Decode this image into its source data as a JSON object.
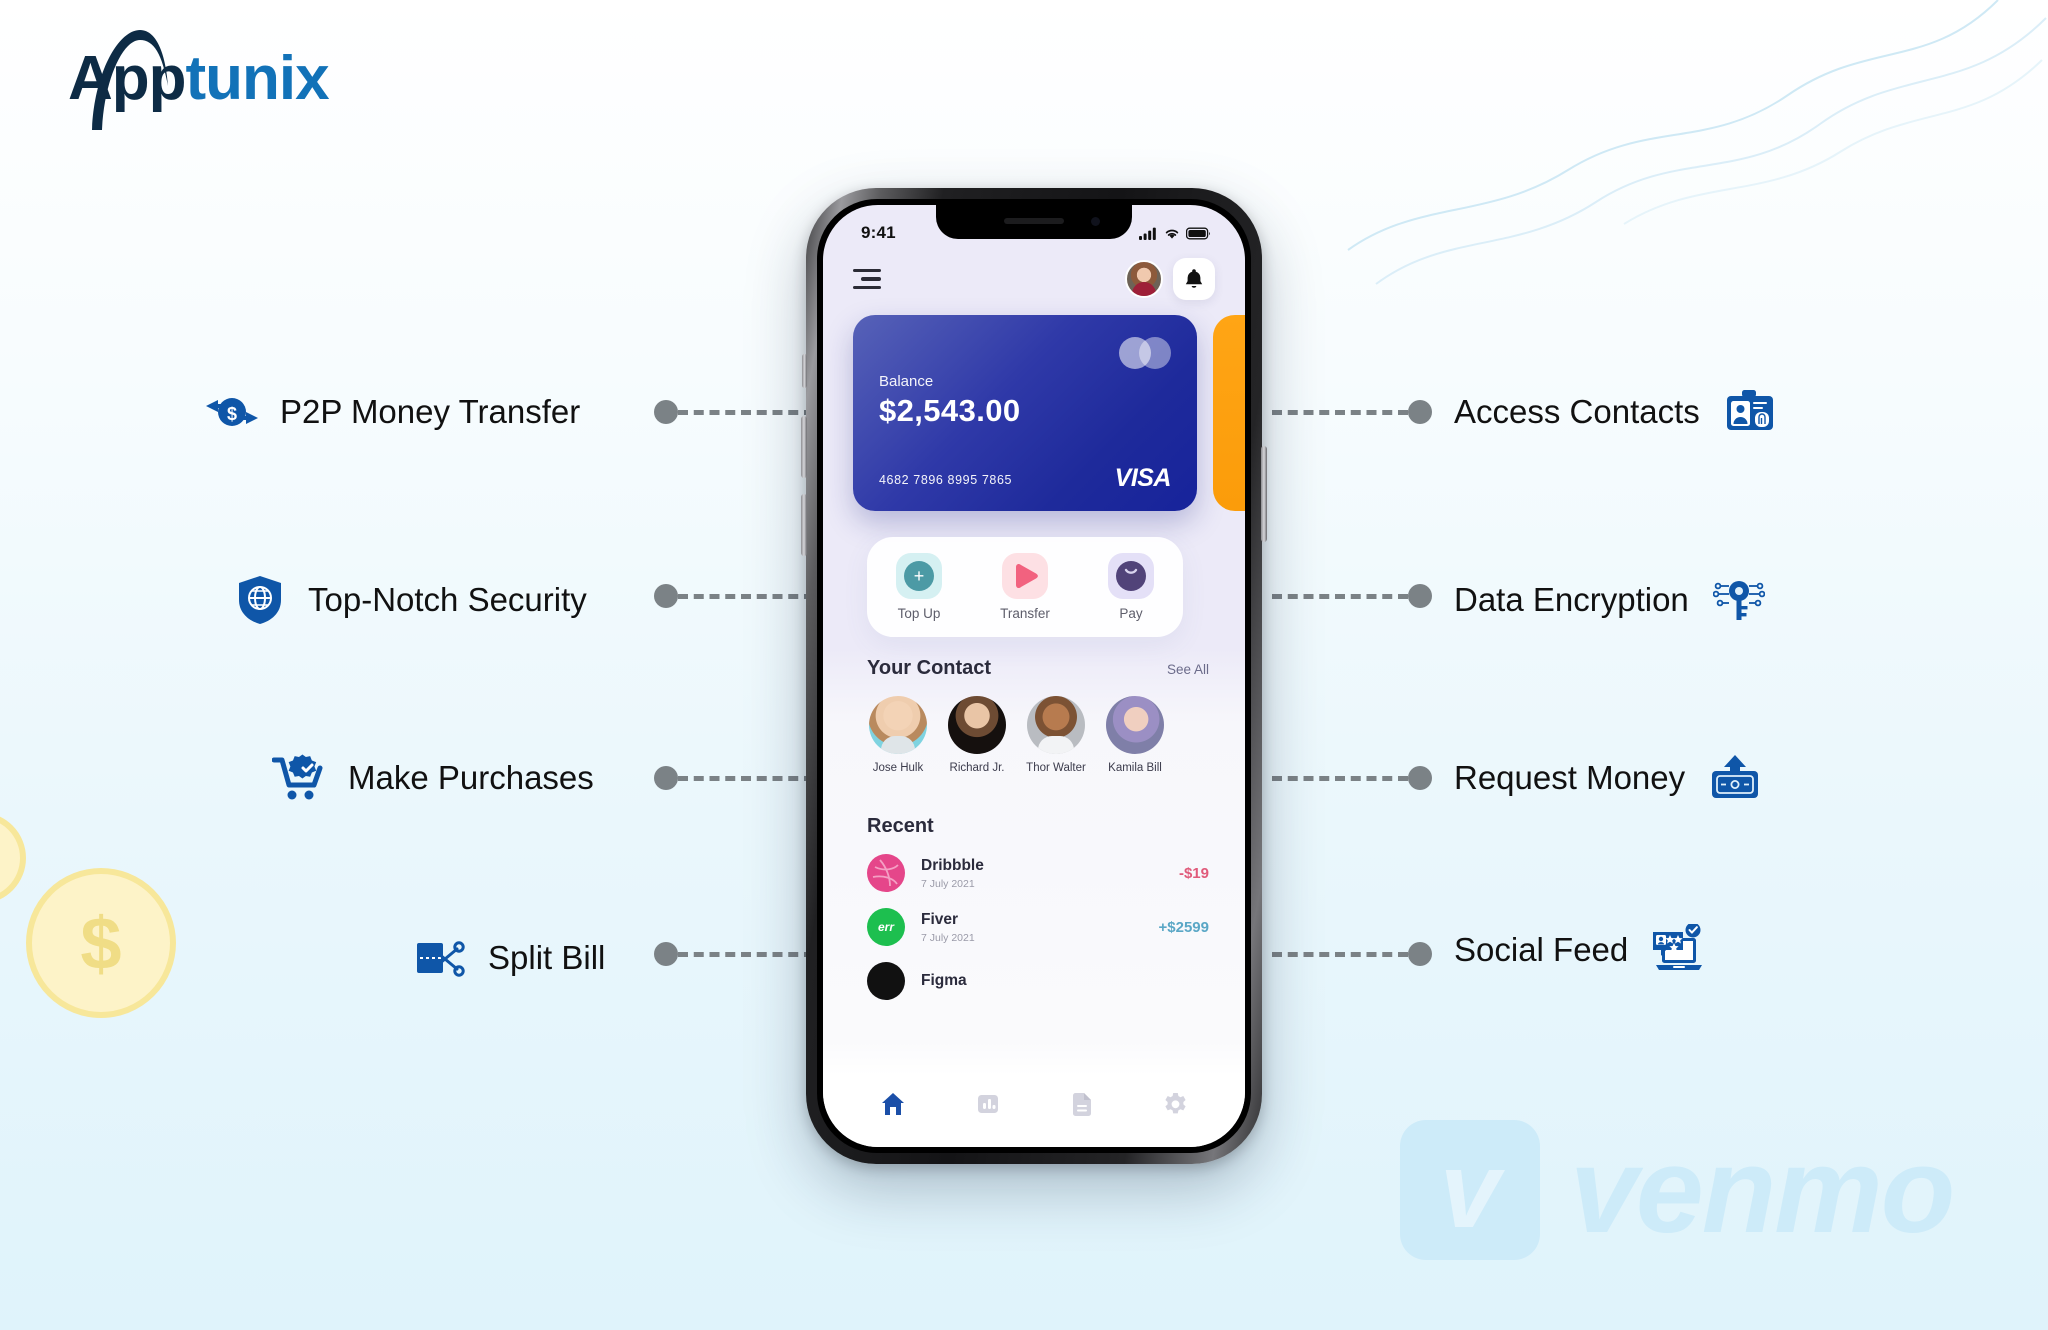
{
  "brand": {
    "logo_app": "App",
    "logo_unix": "tunix"
  },
  "watermark": {
    "venmo_mark": "v",
    "venmo_word": "venmo"
  },
  "features_left": [
    {
      "label": "P2P Money Transfer",
      "icon": "money-transfer-icon"
    },
    {
      "label": "Top-Notch Security",
      "icon": "shield-globe-icon"
    },
    {
      "label": "Make Purchases",
      "icon": "cart-check-icon"
    },
    {
      "label": "Split Bill",
      "icon": "scissors-card-icon"
    }
  ],
  "features_right": [
    {
      "label": "Access Contacts",
      "icon": "id-badge-fingerprint-icon"
    },
    {
      "label": "Data Encryption",
      "icon": "key-circuit-icon"
    },
    {
      "label": "Request Money",
      "icon": "banknote-upload-icon"
    },
    {
      "label": "Social Feed",
      "icon": "laptop-review-icon"
    }
  ],
  "phone": {
    "status_bar": {
      "time": "9:41",
      "signal": "signal-icon",
      "wifi": "wifi-icon",
      "battery": "battery-icon"
    },
    "header": {
      "menu": "hamburger-icon",
      "avatar": "user-avatar",
      "bell": "bell-icon"
    },
    "card": {
      "balance_label": "Balance",
      "balance_amount": "$2,543.00",
      "card_number": "4682 7896 8995 7865",
      "network": "VISA",
      "chip": "mastercard-circles-icon",
      "accent_color": "#1e2a9b",
      "side_card_color": "#fda210"
    },
    "actions": [
      {
        "label": "Top Up",
        "icon": "plus-circle-icon",
        "bg": "#d5f0f2"
      },
      {
        "label": "Transfer",
        "icon": "play-arrow-icon",
        "bg": "#fde0e4"
      },
      {
        "label": "Pay",
        "icon": "pay-crescent-icon",
        "bg": "#e4e0f7"
      }
    ],
    "contacts_section": {
      "title": "Your Contact",
      "see_all": "See All",
      "contacts": [
        {
          "name": "Jose Hulk"
        },
        {
          "name": "Richard Jr."
        },
        {
          "name": "Thor Walter"
        },
        {
          "name": "Kamila Bill"
        }
      ]
    },
    "recent_section": {
      "title": "Recent",
      "transactions": [
        {
          "name": "Dribbble",
          "date": "7 July 2021",
          "amount": "-$19",
          "direction": "negative",
          "logo": "dribbble-logo"
        },
        {
          "name": "Fiver",
          "date": "7 July 2021",
          "amount": "+$2599",
          "direction": "positive",
          "logo": "fiverr-logo"
        },
        {
          "name": "Figma",
          "date": "",
          "amount": "",
          "direction": "positive",
          "logo": "figma-logo"
        }
      ]
    },
    "bottom_nav": [
      {
        "icon": "home-icon",
        "active": true
      },
      {
        "icon": "chart-icon",
        "active": false
      },
      {
        "icon": "document-icon",
        "active": false
      },
      {
        "icon": "gear-icon",
        "active": false
      }
    ]
  }
}
